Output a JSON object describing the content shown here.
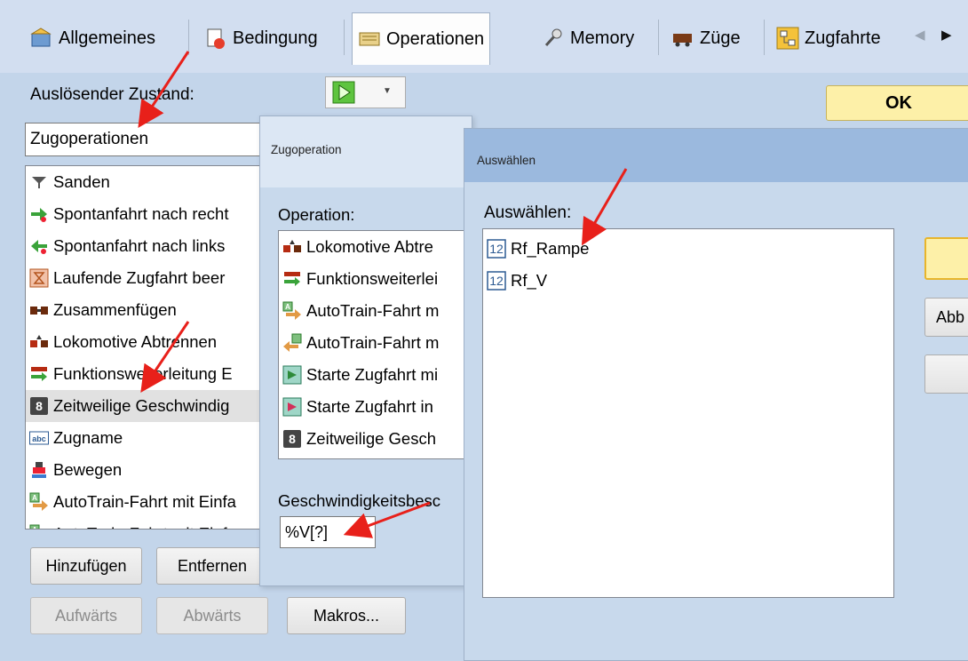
{
  "tabs": [
    {
      "label": "Allgemeines",
      "icon": "settings-icon"
    },
    {
      "label": "Bedingung",
      "icon": "condition-icon"
    },
    {
      "label": "Operationen",
      "icon": "operations-icon",
      "active": true
    },
    {
      "label": "Memory",
      "icon": "memory-icon"
    },
    {
      "label": "Züge",
      "icon": "trains-icon"
    },
    {
      "label": "Zugfahrte",
      "icon": "route-icon"
    }
  ],
  "main": {
    "trigger_label": "Auslösender Zustand:",
    "trigger_value": "Zugoperationen",
    "ok_label": "OK",
    "list": [
      {
        "label": "Sanden",
        "icon": "sand-icon"
      },
      {
        "label": "Spontanfahrt nach recht",
        "icon": "arrow-right-icon"
      },
      {
        "label": "Spontanfahrt nach links",
        "icon": "arrow-left-icon"
      },
      {
        "label": "Laufende Zugfahrt beer",
        "icon": "hourglass-icon"
      },
      {
        "label": "Zusammenfügen",
        "icon": "couple-icon"
      },
      {
        "label": "Lokomotive Abtrennen",
        "icon": "uncouple-icon"
      },
      {
        "label": "Funktionsweiterleitung E",
        "icon": "function-icon"
      },
      {
        "label": "Zeitweilige Geschwindig",
        "icon": "speed-icon",
        "selected": true
      },
      {
        "label": "Zugname",
        "icon": "abc-icon"
      },
      {
        "label": "Bewegen",
        "icon": "move-icon"
      },
      {
        "label": "AutoTrain-Fahrt mit Einfa",
        "icon": "autotrain-icon"
      },
      {
        "label": "AutoTrain-Fahrt mit Einfa",
        "icon": "autotrain-icon"
      }
    ],
    "add_label": "Hinzufügen",
    "remove_label": "Entfernen",
    "up_label": "Aufwärts",
    "down_label": "Abwärts",
    "macros_label": "Makros..."
  },
  "zugop": {
    "title": "Zugoperation",
    "operation_label": "Operation:",
    "list": [
      {
        "label": "Lokomotive Abtre",
        "icon": "uncouple-icon"
      },
      {
        "label": "Funktionsweiterlei",
        "icon": "function-icon"
      },
      {
        "label": "AutoTrain-Fahrt m",
        "icon": "autotrain-icon"
      },
      {
        "label": "AutoTrain-Fahrt m",
        "icon": "autotrain-back-icon"
      },
      {
        "label": "Starte Zugfahrt mi",
        "icon": "start-route-icon"
      },
      {
        "label": "Starte Zugfahrt in",
        "icon": "start-route-red-icon"
      },
      {
        "label": "Zeitweilige Gesch",
        "icon": "speed-icon"
      }
    ],
    "speed_label": "Geschwindigkeitsbesc",
    "speed_value": "%V[?]"
  },
  "auswahl": {
    "title": "Auswählen",
    "label": "Auswählen:",
    "items": [
      {
        "label": "Rf_Rampe",
        "icon": "number-icon"
      },
      {
        "label": "Rf_V",
        "icon": "number-icon"
      }
    ],
    "cancel_label": "Abb",
    "number_glyph": "12"
  },
  "colors": {
    "ok_bg": "#fdf0a8",
    "arrow": "#e8201a",
    "selection": "#e1e1e1"
  }
}
